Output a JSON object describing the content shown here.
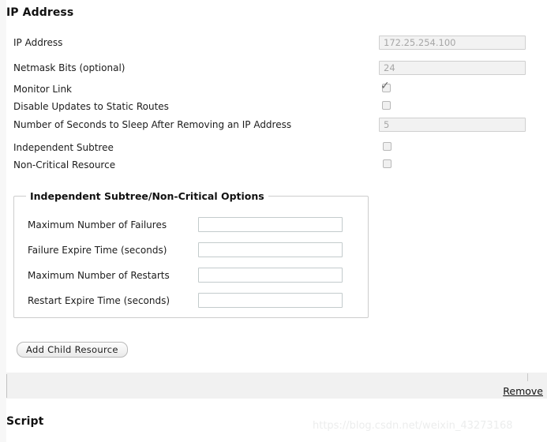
{
  "sections": {
    "ip_title": "IP Address",
    "script_title": "Script"
  },
  "form": {
    "rows": [
      {
        "label": "IP Address",
        "type": "text",
        "value": "172.25.254.100"
      },
      {
        "label": "Netmask Bits (optional)",
        "type": "text",
        "value": "24"
      },
      {
        "label": "Monitor Link",
        "type": "checkbox",
        "checked": true
      },
      {
        "label": "Disable Updates to Static Routes",
        "type": "checkbox",
        "checked": false
      },
      {
        "label": "Number of Seconds to Sleep After Removing an IP Address",
        "type": "text",
        "value": "5"
      },
      {
        "label": "Independent Subtree",
        "type": "checkbox",
        "checked": false
      },
      {
        "label": "Non-Critical Resource",
        "type": "checkbox",
        "checked": false
      }
    ]
  },
  "fieldset": {
    "legend": "Independent Subtree/Non-Critical Options",
    "rows": [
      {
        "label": "Maximum Number of Failures",
        "value": ""
      },
      {
        "label": "Failure Expire Time (seconds)",
        "value": ""
      },
      {
        "label": "Maximum Number of Restarts",
        "value": ""
      },
      {
        "label": "Restart Expire Time (seconds)",
        "value": ""
      }
    ]
  },
  "actions": {
    "add_child_resource": "Add Child Resource",
    "remove": "Remove"
  },
  "watermark": "https://blog.csdn.net/weixin_43273168",
  "colors": {
    "band": "#f1f1f1",
    "input_disabled_bg": "#f2f2f2",
    "input_border": "#cfcfcf",
    "text": "#1a1a1a"
  }
}
